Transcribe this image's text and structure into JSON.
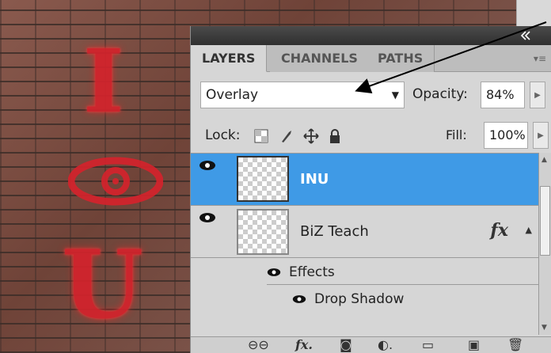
{
  "background": {
    "graffiti_top": "I",
    "graffiti_bottom": "U"
  },
  "panel": {
    "tabs": [
      "LAYERS",
      "CHANNELS",
      "PATHS"
    ],
    "blend_mode": "Overlay",
    "opacity_label": "Opacity:",
    "opacity_value": "84%",
    "lock_label": "Lock:",
    "fill_label": "Fill:",
    "fill_value": "100%",
    "layers": [
      {
        "name": "INU",
        "selected": true
      },
      {
        "name": "BiZ Teach",
        "selected": false,
        "badge": "fx"
      }
    ],
    "effects": {
      "group_label": "Effects",
      "items": [
        "Drop Shadow"
      ]
    }
  },
  "colors": {
    "accent": "#3f9ae6",
    "panel_bg": "#d6d6d6",
    "titlebar": "#3a3a3a",
    "graffiti": "#d4232c"
  }
}
